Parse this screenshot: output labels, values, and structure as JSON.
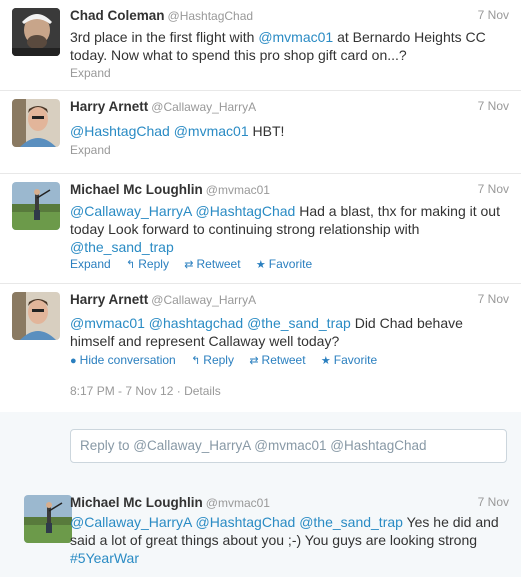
{
  "tweets": [
    {
      "name": "Chad Coleman",
      "handle": "@HashtagChad",
      "time": "7 Nov",
      "segments": [
        {
          "text": "3rd place in the first flight with ",
          "mention": false
        },
        {
          "text": "@mvmac01",
          "mention": true
        },
        {
          "text": " at Bernardo Heights CC today. Now what to spend this pro shop gift card on...?",
          "mention": false
        }
      ],
      "expand": "Expand"
    },
    {
      "name": "Harry Arnett",
      "handle": "@Callaway_HarryA",
      "time": "7 Nov",
      "segments": [
        {
          "text": "@HashtagChad",
          "mention": true
        },
        {
          "text": " ",
          "mention": false
        },
        {
          "text": "@mvmac01",
          "mention": true
        },
        {
          "text": " HBT!",
          "mention": false
        }
      ],
      "expand": "Expand"
    },
    {
      "name": "Michael Mc Loughlin",
      "handle": "@mvmac01",
      "time": "7 Nov",
      "segments": [
        {
          "text": "@Callaway_HarryA",
          "mention": true
        },
        {
          "text": " ",
          "mention": false
        },
        {
          "text": "@HashtagChad",
          "mention": true
        },
        {
          "text": " Had a blast, thx for making it out today Look forward to continuing strong relationship with ",
          "mention": false
        },
        {
          "text": "@the_sand_trap",
          "mention": true
        }
      ],
      "actions": {
        "expand": "Expand",
        "reply": "Reply",
        "retweet": "Retweet",
        "favorite": "Favorite"
      }
    },
    {
      "name": "Harry Arnett",
      "handle": "@Callaway_HarryA",
      "time": "7 Nov",
      "segments": [
        {
          "text": "@mvmac01",
          "mention": true
        },
        {
          "text": " ",
          "mention": false
        },
        {
          "text": "@hashtagchad",
          "mention": true
        },
        {
          "text": " ",
          "mention": false
        },
        {
          "text": "@the_sand_trap",
          "mention": true
        },
        {
          "text": " Did Chad behave himself and represent Callaway well today?",
          "mention": false
        }
      ],
      "actions": {
        "hide": "Hide conversation",
        "reply": "Reply",
        "retweet": "Retweet",
        "favorite": "Favorite"
      },
      "timestamp": "8:17 PM - 7 Nov 12",
      "details": "Details"
    },
    {
      "name": "Michael Mc Loughlin",
      "handle": "@mvmac01",
      "time": "7 Nov",
      "segments": [
        {
          "text": "@Callaway_HarryA",
          "mention": true
        },
        {
          "text": " ",
          "mention": false
        },
        {
          "text": "@HashtagChad",
          "mention": true
        },
        {
          "text": " ",
          "mention": false
        },
        {
          "text": "@the_sand_trap",
          "mention": true
        },
        {
          "text": " Yes he did and said a lot of great things about you ;-) You guys are looking strong ",
          "mention": false
        },
        {
          "text": "#5YearWar",
          "mention": true
        }
      ]
    }
  ],
  "reply_box": {
    "placeholder": "Reply to @Callaway_HarryA @mvmac01 @HashtagChad"
  },
  "icons": {
    "reply": "reply-arrow-icon",
    "retweet": "retweet-icon",
    "favorite": "star-icon",
    "hide": "hide-icon"
  },
  "colors": {
    "link": "#2a8bc4",
    "muted": "#999999",
    "nested_bg": "#f5f8fa"
  }
}
